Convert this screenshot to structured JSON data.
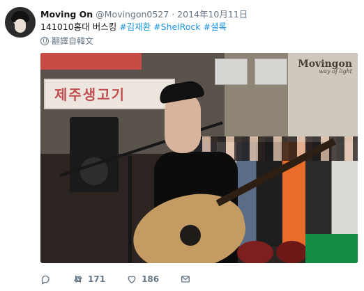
{
  "tweet": {
    "display_name": "Moving On",
    "handle": "@Movingon0527",
    "separator": "·",
    "date": "2014年10月11日",
    "text_prefix": "141010홍대 버스킹",
    "hashtags": [
      "#김재환",
      "#ShelRock",
      "#셜록"
    ],
    "translate_label": "翻譯自韓文",
    "image_watermark_title": "Movingon",
    "image_watermark_subtitle": "way of light",
    "image_sign_text": "제주생고기",
    "actions": {
      "reply_icon": "reply-icon",
      "retweet_icon": "retweet-icon",
      "retweet_count": "171",
      "like_icon": "like-icon",
      "like_count": "186",
      "dm_icon": "mail-icon"
    }
  }
}
